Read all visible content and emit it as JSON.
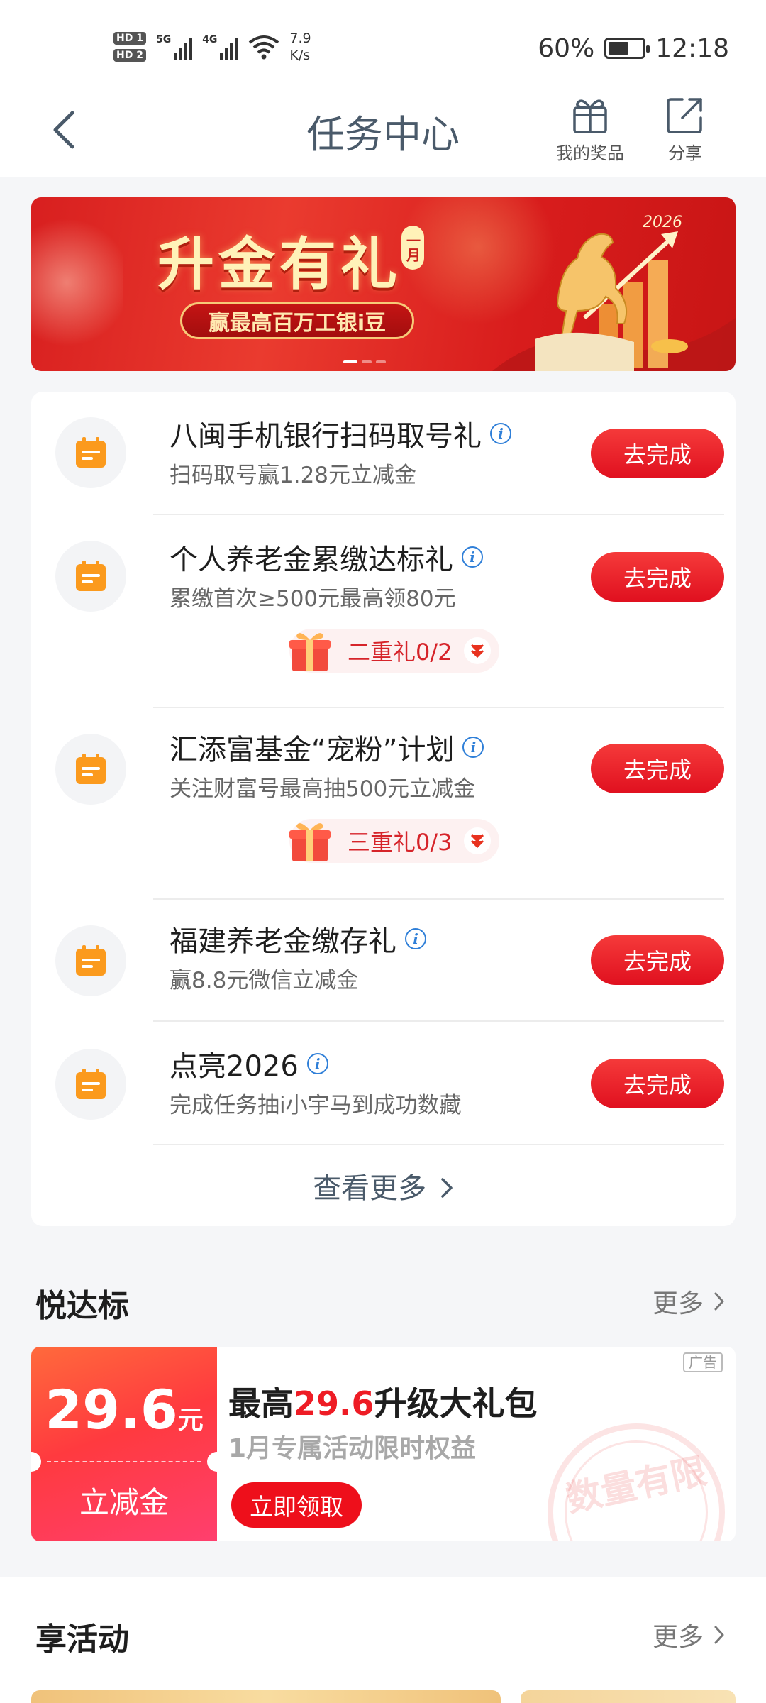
{
  "status_bar": {
    "hd1": "HD 1",
    "hd2": "HD 2",
    "net1": "5G",
    "net2": "4G",
    "speed_value": "7.9",
    "speed_unit": "K/s",
    "battery": "60%",
    "battery_level": 0.6,
    "time": "12:18"
  },
  "nav": {
    "title": "任务中心",
    "prizes_label": "我的奖品",
    "share_label": "分享"
  },
  "banner": {
    "title": "升金有礼",
    "tag": "一月",
    "subtitle": "赢最高百万工银i豆",
    "year_art": "2026"
  },
  "tasks": [
    {
      "title": "八闽手机银行扫码取号礼",
      "desc": "扫码取号赢1.28元立减金",
      "button": "去完成"
    },
    {
      "title": "个人养老金累缴达标礼",
      "desc": "累缴首次≥500元最高领80元",
      "button": "去完成",
      "gift": "二重礼0/2"
    },
    {
      "title": "汇添富基金“宠粉”计划",
      "desc": "关注财富号最高抽500元立减金",
      "button": "去完成",
      "gift": "三重礼0/3"
    },
    {
      "title": "福建养老金缴存礼",
      "desc": "赢8.8元微信立减金",
      "button": "去完成"
    },
    {
      "title": "点亮2026",
      "desc": "完成任务抽i小宇马到成功数藏",
      "button": "去完成"
    }
  ],
  "see_more": "查看更多",
  "section_yuedabiao": {
    "title": "悦达标",
    "more": "更多"
  },
  "promo": {
    "amount": "29.6",
    "unit": "元",
    "coupon_label": "立减金",
    "title_prefix": "最高",
    "title_highlight": "29.6",
    "title_suffix": "升级大礼包",
    "subtitle": "1月专属活动限时权益",
    "button": "立即领取",
    "ad_badge": "广告",
    "stamp": "数量有限"
  },
  "section_activities": {
    "title": "享活动",
    "more": "更多"
  },
  "colors": {
    "accent_red": "#ee1c25",
    "icon_orange": "#fb9a1d",
    "info_blue": "#2f7fd8",
    "title_slate": "#4a5a6a"
  }
}
